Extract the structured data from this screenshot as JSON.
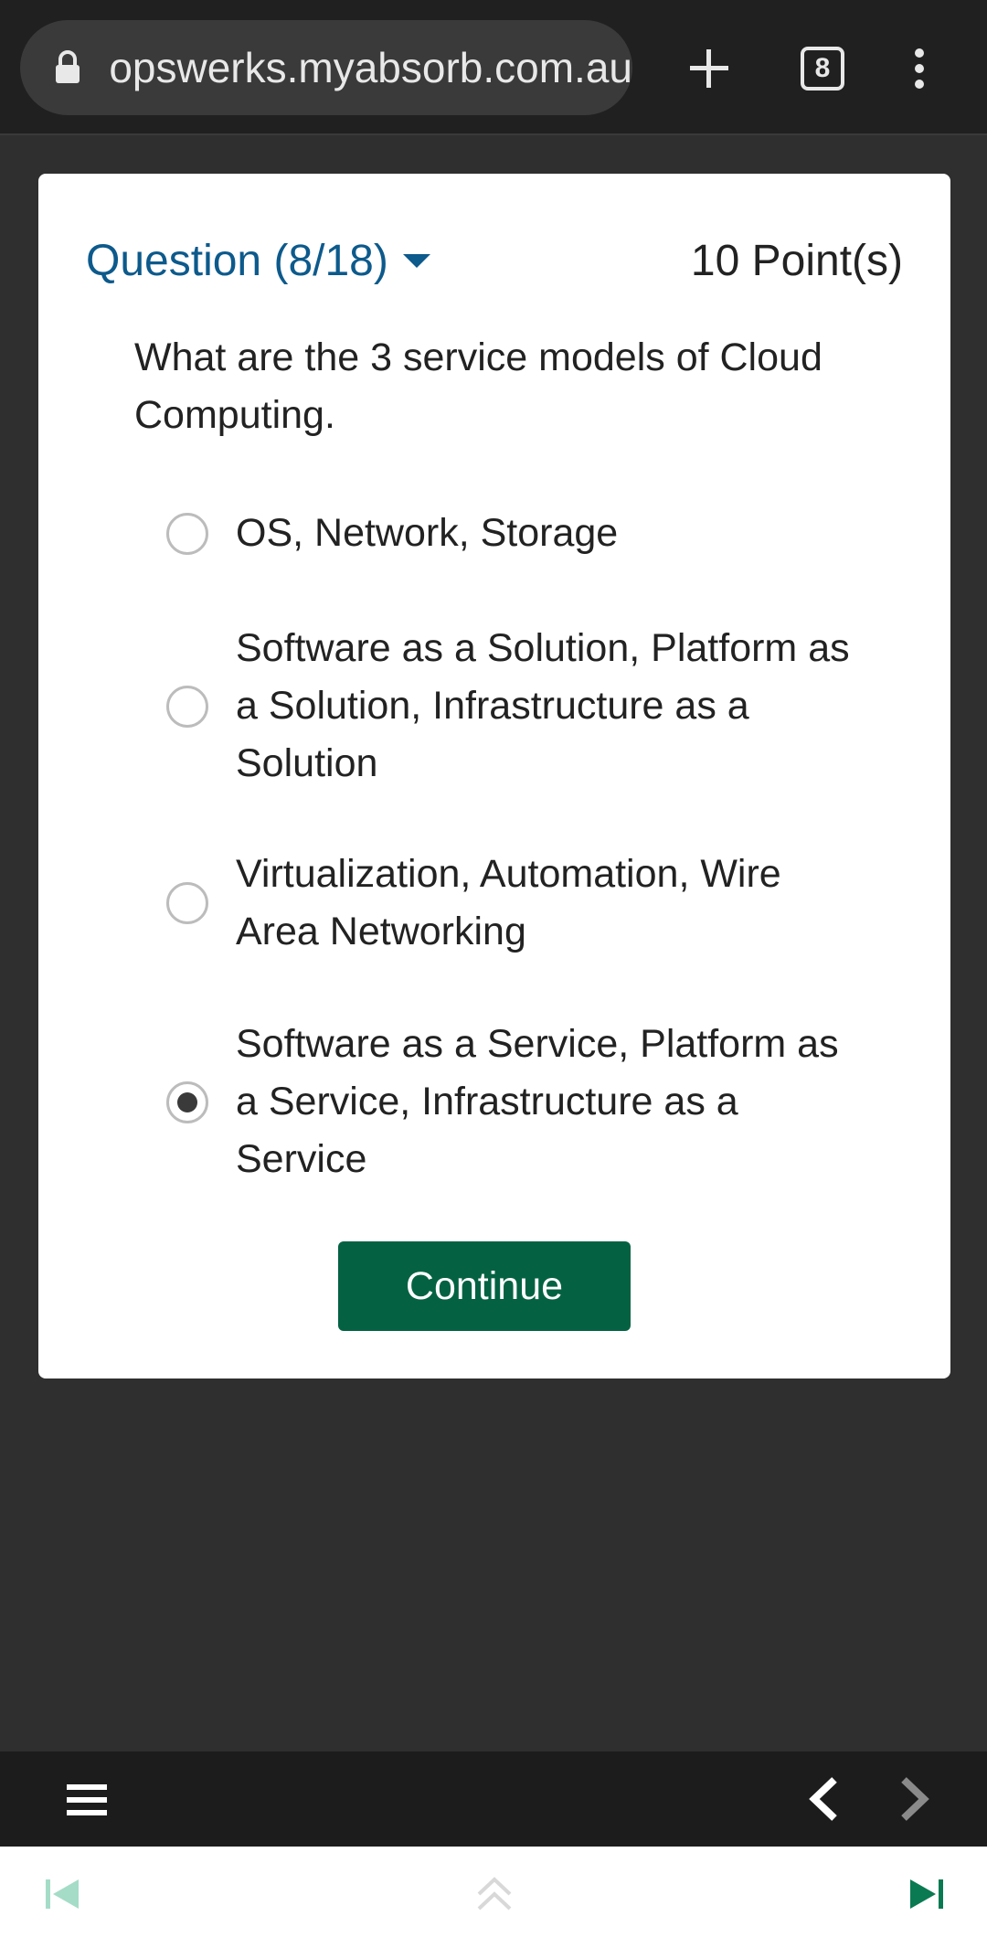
{
  "browser": {
    "url": "opswerks.myabsorb.com.au",
    "tab_count": "8",
    "icons": {
      "lock": "lock-icon",
      "new_tab": "plus-icon",
      "tabs": "tab-switcher-icon",
      "menu": "more-vert-icon"
    }
  },
  "question": {
    "header": "Question (8/18)",
    "points": "10 Point(s)",
    "text": "What are the 3 service models of Cloud Computing.",
    "options": [
      {
        "label": "OS, Network, Storage",
        "selected": false
      },
      {
        "label": "Software as a Solution, Platform as a Solution, Infrastructure as a Solution",
        "selected": false
      },
      {
        "label": "Virtualization, Automation, Wire Area Networking",
        "selected": false
      },
      {
        "label": "Software as a Service, Platform as a Service, Infrastructure as a Service",
        "selected": true
      }
    ],
    "continue_label": "Continue"
  },
  "colors": {
    "accent_blue": "#0d5a8c",
    "continue_green": "#046243",
    "next_green": "#0a7a52",
    "first_disabled": "#a5dcc8"
  }
}
